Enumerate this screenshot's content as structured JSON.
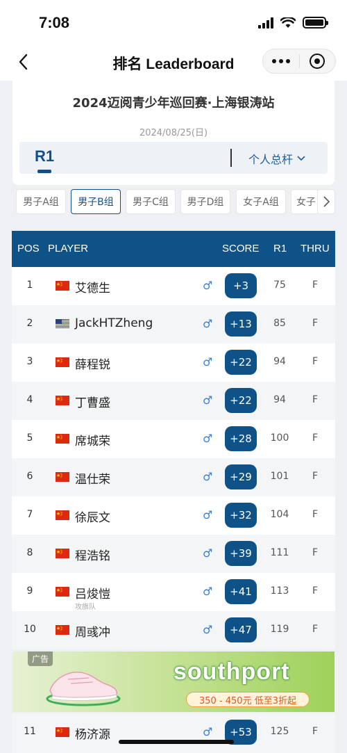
{
  "status_bar": {
    "time": "7:08"
  },
  "nav": {
    "title": "排名 Leaderboard"
  },
  "event": {
    "title": "2024迈阅青少年巡回赛·上海银涛站",
    "date": "2024/08/25(日)",
    "round": "R1",
    "view_select": "个人总杆"
  },
  "group_tabs": [
    "男子A组",
    "男子B组",
    "男子C组",
    "男子D组",
    "女子A组",
    "女子"
  ],
  "active_group": "男子B组",
  "table": {
    "headers": {
      "pos": "POS",
      "player": "PLAYER",
      "score": "SCORE",
      "r1": "R1",
      "thru": "THRU"
    },
    "gender_symbol": "♂",
    "rows": [
      {
        "pos": "1",
        "flag": "CN",
        "name": "艾德生",
        "score": "+3",
        "r1": "75",
        "thru": "F"
      },
      {
        "pos": "2",
        "flag": "US",
        "name": "JackHTZheng",
        "score": "+13",
        "r1": "85",
        "thru": "F"
      },
      {
        "pos": "3",
        "flag": "CN",
        "name": "薛程锐",
        "score": "+22",
        "r1": "94",
        "thru": "F"
      },
      {
        "pos": "4",
        "flag": "CN",
        "name": "丁曹盛",
        "score": "+22",
        "r1": "94",
        "thru": "F"
      },
      {
        "pos": "5",
        "flag": "CN",
        "name": "席城荣",
        "score": "+28",
        "r1": "100",
        "thru": "F"
      },
      {
        "pos": "6",
        "flag": "CN",
        "name": "温仕荣",
        "score": "+29",
        "r1": "101",
        "thru": "F"
      },
      {
        "pos": "7",
        "flag": "CN",
        "name": "徐辰文",
        "score": "+32",
        "r1": "104",
        "thru": "F"
      },
      {
        "pos": "8",
        "flag": "CN",
        "name": "程浩铭",
        "score": "+39",
        "r1": "111",
        "thru": "F"
      },
      {
        "pos": "9",
        "flag": "CN",
        "name": "吕焌愷",
        "team": "攻旗队",
        "score": "+41",
        "r1": "113",
        "thru": "F"
      },
      {
        "pos": "10",
        "flag": "CN",
        "name": "周彧冲",
        "score": "+47",
        "r1": "119",
        "thru": "F"
      }
    ],
    "row_after_ad": {
      "pos": "11",
      "flag": "CN",
      "name": "杨济源",
      "score": "+53",
      "r1": "125",
      "thru": "F"
    }
  },
  "ad": {
    "tag": "广告",
    "brand": "southport",
    "promo": "350 - 450元  低至3折起"
  },
  "colors": {
    "primary": "#0f5287",
    "male": "#3b7fd1",
    "flag_cn": "#de2910"
  }
}
